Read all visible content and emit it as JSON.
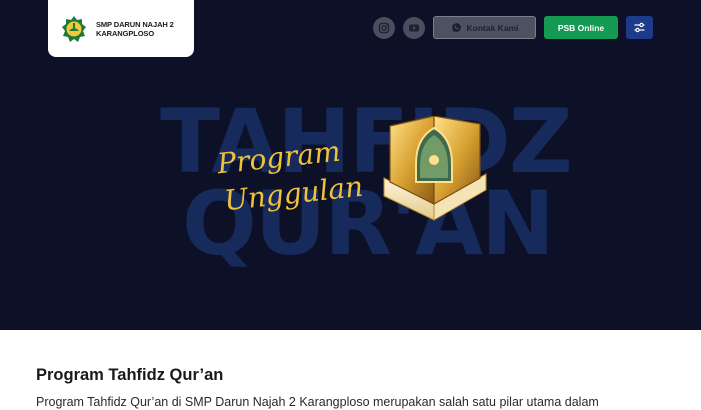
{
  "header": {
    "school_name_line1": "SMP DARUN NAJAH 2",
    "school_name_line2": "KARANGPLOSO",
    "logo_icon": "school-emblem-icon",
    "nav": {
      "instagram_icon": "instagram-icon",
      "youtube_icon": "youtube-icon",
      "contact_label": "Kontak Kami",
      "contact_icon": "whatsapp-icon",
      "psb_label": "PSB Online",
      "settings_icon": "sliders-icon"
    }
  },
  "hero": {
    "bg_word_1": "TAHFIDZ",
    "bg_word_2": "QUR'AN",
    "script_line1": "Program",
    "script_line2": "Unggulan",
    "illustration_icon": "quran-book-icon"
  },
  "content": {
    "title": "Program Tahfidz Qur’an",
    "text": "Program Tahfidz Qur’an di SMP Darun Najah 2 Karangploso merupakan salah satu pilar utama dalam"
  },
  "colors": {
    "hero_bg": "#0c1128",
    "bg_word": "#172a5c",
    "script_gold": "#f0c23c",
    "psb_green": "#149a52",
    "settings_blue": "#1e3a8a"
  }
}
